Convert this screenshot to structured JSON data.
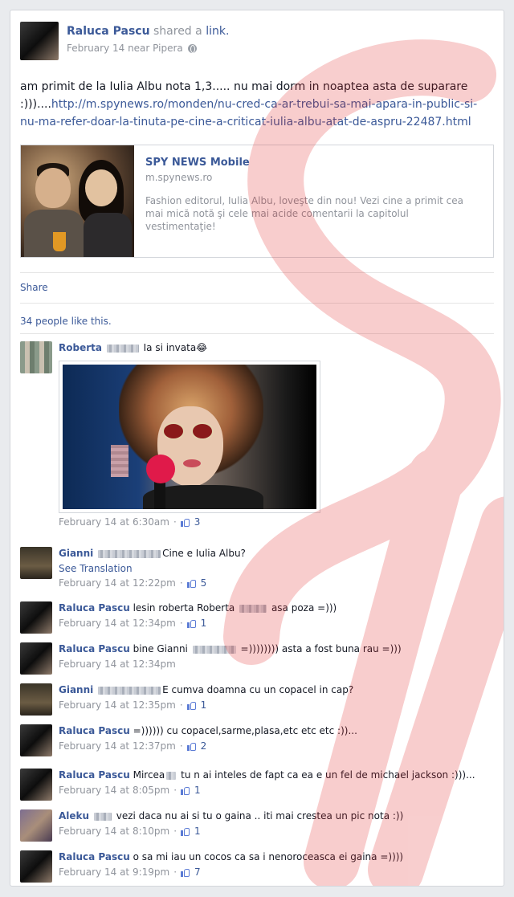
{
  "post": {
    "author": "Raluca Pascu",
    "action": "shared a",
    "action_link": "link.",
    "date_location": "February 14 near Pipera",
    "text": "am primit de la Iulia Albu nota 1,3..... nu mai dorm in noaptea asta de suparare :)))....",
    "url": "http://m.spynews.ro/monden/nu-cred-ca-ar-trebui-sa-mai-apara-in-public-si-nu-ma-refer-doar-la-tinuta-pe-cine-a-criticat-iulia-albu-atat-de-aspru-22487.html"
  },
  "attachment": {
    "title": "SPY NEWS Mobile",
    "domain": "m.spynews.ro",
    "description": "Fashion editorul, Iulia Albu, loveşte din nou! Vezi cine a primit cea mai mică notă şi cele mai acide comentarii la capitolul vestimentaţie!"
  },
  "actions": {
    "share": "Share"
  },
  "likes_text": "34 people like this.",
  "comments": [
    {
      "author": "Roberta",
      "text": "Ia si invata😂",
      "meta": "February 14 at 6:30am",
      "likes": "3"
    },
    {
      "author": "Gianni",
      "text": "Cine e Iulia Albu?",
      "see_translation": "See Translation",
      "meta": "February 14 at 12:22pm",
      "likes": "5"
    },
    {
      "author": "Raluca Pascu",
      "text_a": "lesin roberta Roberta",
      "text_b": "asa poza =)))",
      "meta": "February 14 at 12:34pm",
      "likes": "1"
    },
    {
      "author": "Raluca Pascu",
      "text_a": "bine Gianni",
      "text_b": "=)))))))) asta a fost buna rau =)))",
      "meta": "February 14 at 12:34pm"
    },
    {
      "author": "Gianni",
      "text": "E cumva doamna cu un copacel in cap?",
      "meta": "February 14 at 12:35pm",
      "likes": "1"
    },
    {
      "author": "Raluca Pascu",
      "text": "=)))))) cu copacel,sarme,plasa,etc etc etc :))...",
      "meta": "February 14 at 12:37pm",
      "likes": "2"
    },
    {
      "author": "Raluca Pascu",
      "text_a": "Mircea",
      "text_b": "tu n ai inteles de fapt ca ea e un fel de michael jackson :)))...",
      "meta": "February 14 at 8:05pm",
      "likes": "1"
    },
    {
      "author": "Aleku",
      "text": "vezi daca nu ai si tu o gaina .. iti mai crestea un pic nota :))",
      "meta": "February 14 at 8:10pm",
      "likes": "1"
    },
    {
      "author": "Raluca Pascu",
      "text": "o sa mi iau un cocos ca sa i nenoroceasca ei gaina =))))",
      "meta": "February 14 at 9:19pm",
      "likes": "7"
    }
  ]
}
